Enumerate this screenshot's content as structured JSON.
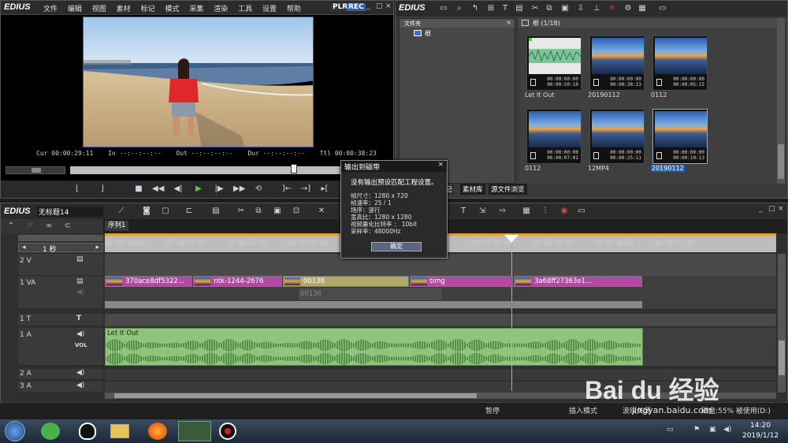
{
  "player": {
    "logo": "EDIUS",
    "menu": [
      "文件",
      "编辑",
      "视图",
      "素材",
      "标记",
      "模式",
      "采集",
      "渲染",
      "工具",
      "设置",
      "帮助"
    ],
    "badge_plr": "PLR",
    "badge_rec": "REC",
    "cur_label": "Cur",
    "cur": "00:00:29:11",
    "in_label": "In",
    "in": "--:--:--:--",
    "out_label": "Out",
    "out": "--:--:--:--",
    "dur_label": "Dur",
    "dur": "--:--:--:--",
    "ttl_label": "Ttl",
    "ttl": "00:00:38:23"
  },
  "bin": {
    "logo": "EDIUS",
    "folder_header": "文件夹",
    "root_folder": "根",
    "path": "根 (1/18)",
    "tabs": [
      "记",
      "素材库",
      "源文件浏览"
    ],
    "clips": [
      {
        "name": "Let It Out",
        "tc1": "00:00:00:00",
        "tc2": "00:00:50:10",
        "kind": "audio"
      },
      {
        "name": "20190112",
        "tc1": "00:00:00:00",
        "tc2": "00:00:38:23",
        "kind": "video"
      },
      {
        "name": "0112",
        "tc1": "00:00:00:00",
        "tc2": "00:00:05:15",
        "kind": "video"
      },
      {
        "name": "0112",
        "tc1": "00:00:00:00",
        "tc2": "00:00:07:01",
        "kind": "video"
      },
      {
        "name": "12MP4",
        "tc1": "00:00:00:00",
        "tc2": "00:00:25:11",
        "kind": "video"
      },
      {
        "name": "20190112",
        "tc1": "00:00:00:00",
        "tc2": "00:00:19:13",
        "kind": "video",
        "selected": true
      }
    ]
  },
  "dialog": {
    "title": "输出到磁带",
    "message": "没有输出预设匹配工程设置。",
    "lines": [
      "帧尺寸：1280 x 720",
      "帧速率：25 / 1",
      "场序：逐行",
      "宽高比：1280 x 1280",
      "视频量化比特率 ： 10bit",
      "采样率：48000Hz"
    ],
    "ok": "确定"
  },
  "timeline": {
    "logo": "EDIUS",
    "project": "无标题14",
    "sequence_tab": "序列1",
    "scale": "1 秒",
    "ruler": [
      "00:00:00:00",
      "00:00:05:00",
      "00:00:10:00",
      "00:00:15:00",
      "00:00:20:00",
      "00:00:25:00",
      "00:00:30:00",
      "00:00:35:00",
      "00:00:40:00",
      "00:00:45:00"
    ],
    "tracks": {
      "v2": "2 V",
      "va1": "1 VA",
      "t1": "1 T",
      "a1": "1 A",
      "vol": "VOL",
      "a2": "2 A",
      "a3": "3 A"
    },
    "clips_va": [
      {
        "name": "370ace8df5322...",
        "start": 0,
        "end": 11.2,
        "color": "#b04aa6"
      },
      {
        "name": "ntk-1244-2676",
        "start": 11.2,
        "end": 22.5,
        "color": "#b04aa6"
      },
      {
        "name": "00138",
        "start": 22.5,
        "end": 38.5,
        "color": "#b2a86a"
      },
      {
        "name": "timg",
        "start": 38.5,
        "end": 51.7,
        "color": "#b04aa6"
      },
      {
        "name": "3a68ff27363e1...",
        "start": 51.7,
        "end": 68.0,
        "color": "#b04aa6"
      }
    ],
    "ghost_clip": "00136",
    "audio_clip": "Let It Out"
  },
  "status": {
    "state": "暂停",
    "insert_mode": "插入模式",
    "ripple": "波纹关闭",
    "disk": "磁盘:55% 被使用(D:)"
  },
  "taskbar": {
    "time": "14:20",
    "date": "2019/1/12"
  },
  "watermark": {
    "brand": "Bai du 经验",
    "url": "jingyan.baidu.com"
  }
}
